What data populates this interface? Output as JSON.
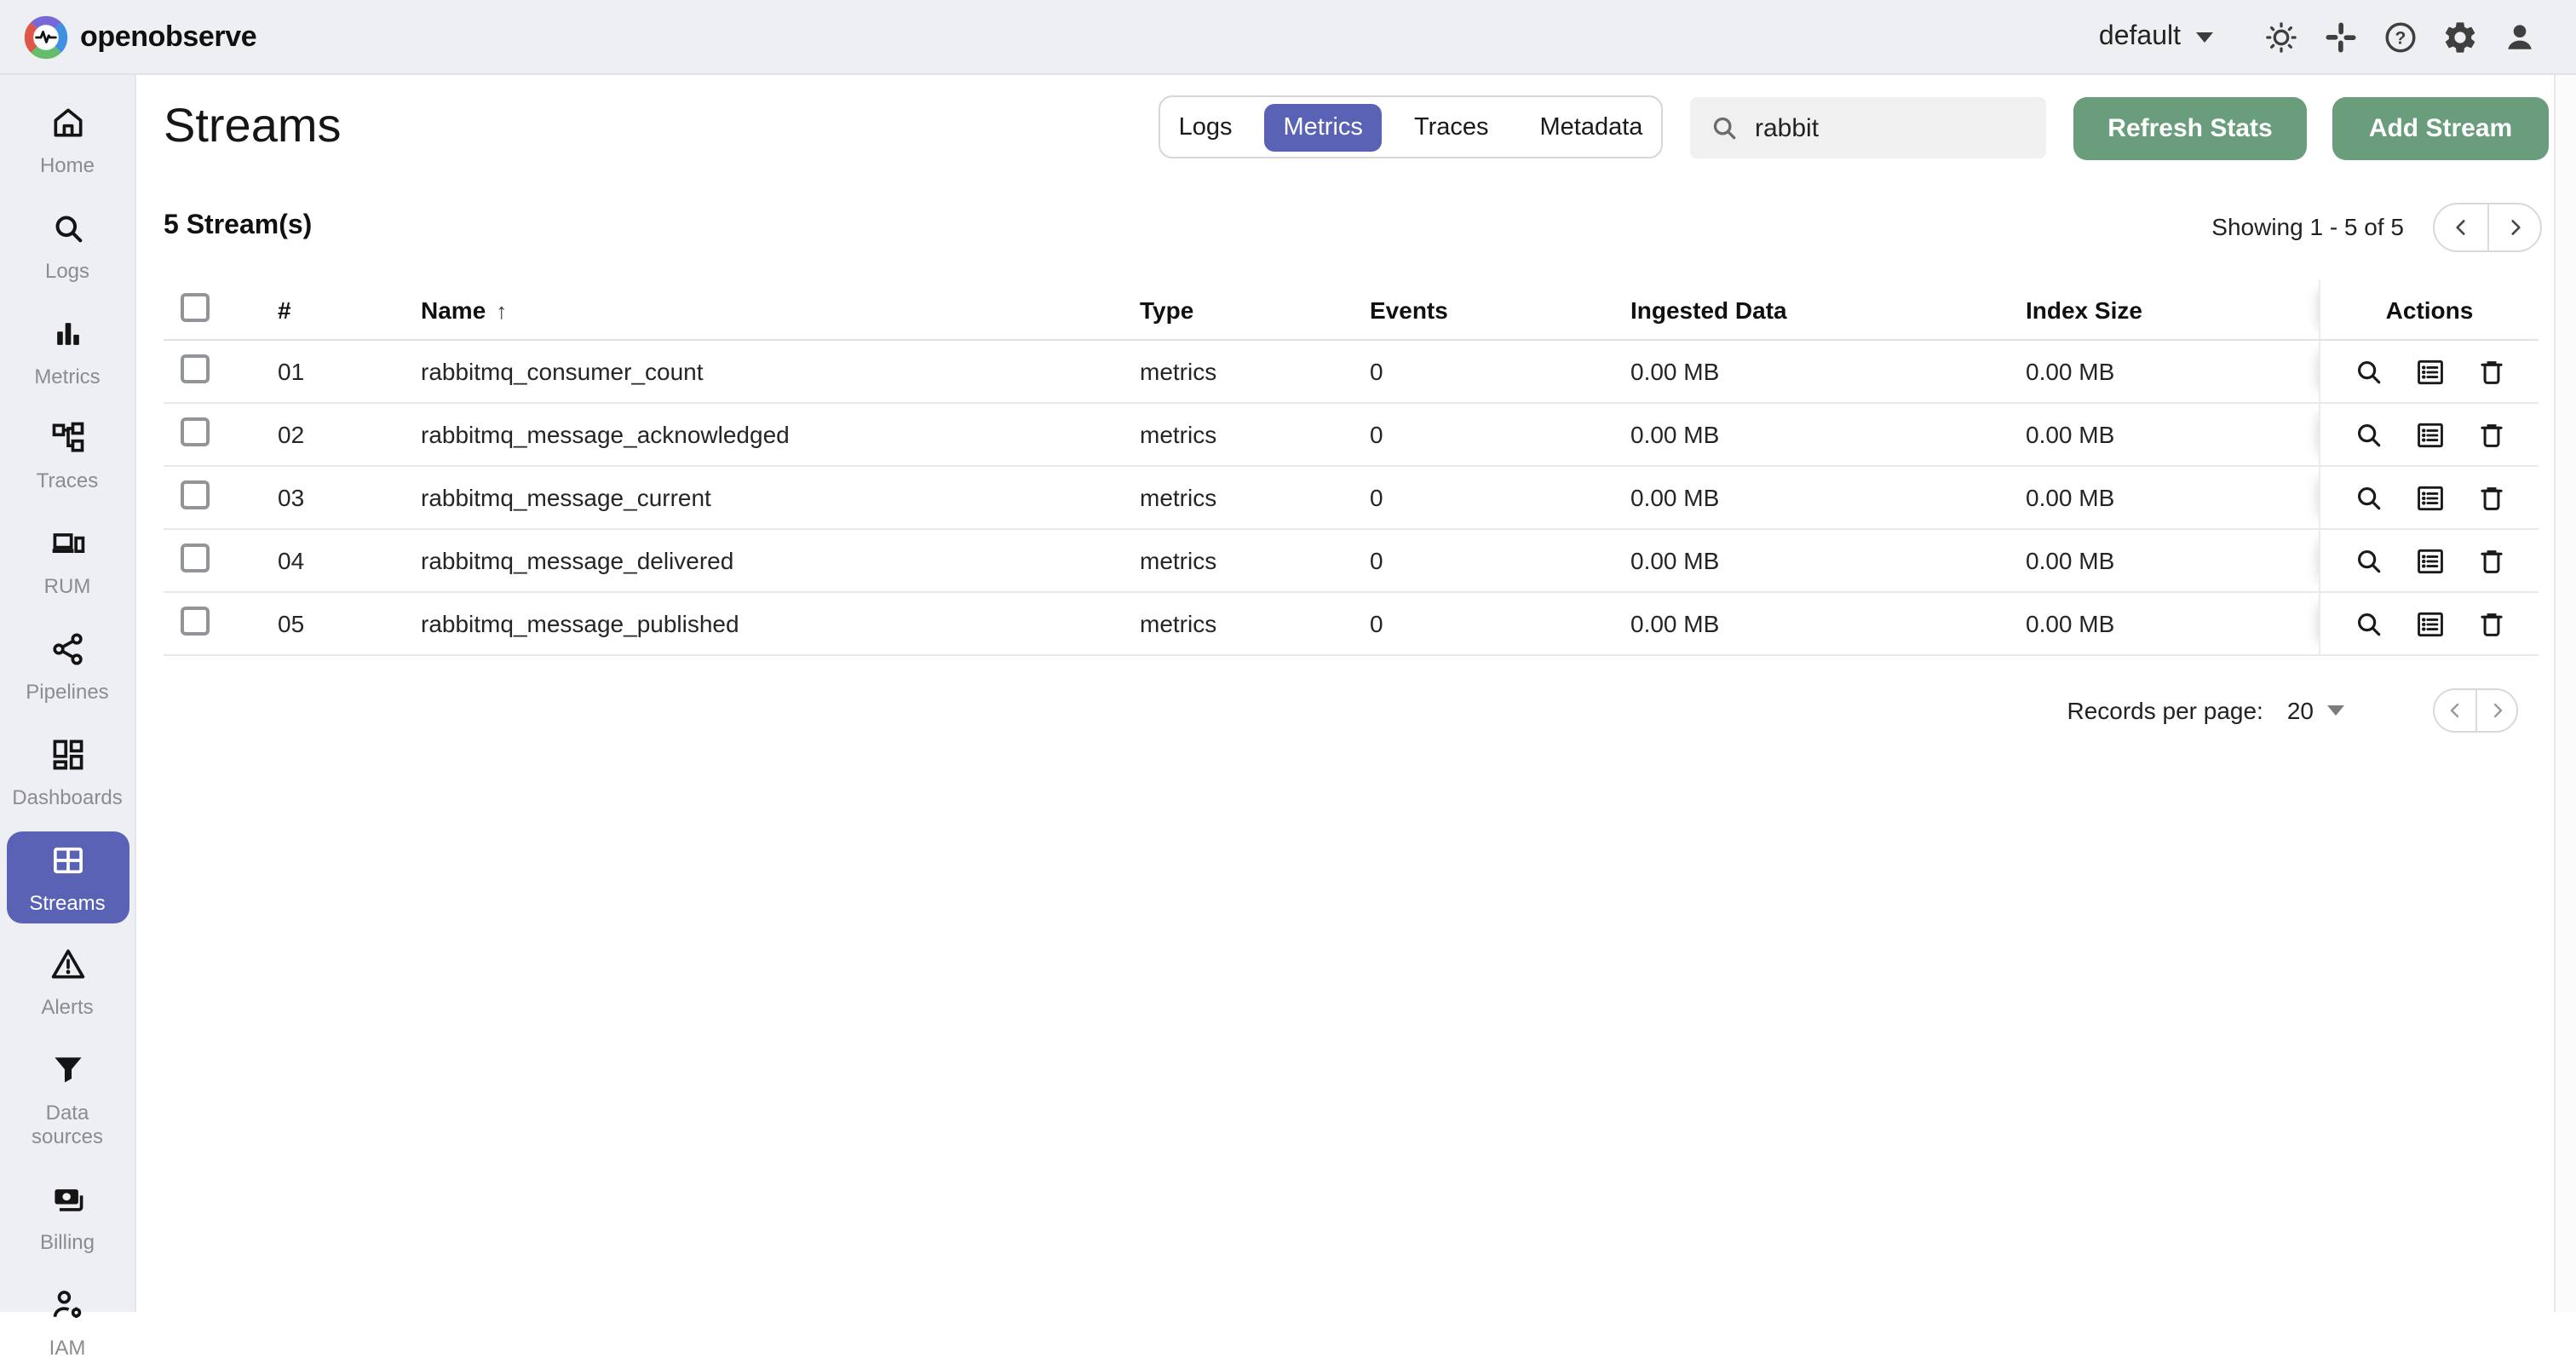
{
  "topbar": {
    "brand": "openobserve",
    "org": {
      "value": "default"
    },
    "icons": [
      {
        "name": "theme-toggle-icon"
      },
      {
        "name": "slack-icon"
      },
      {
        "name": "help-icon"
      },
      {
        "name": "settings-icon"
      },
      {
        "name": "profile-icon"
      }
    ]
  },
  "sidebar": {
    "items": [
      {
        "label": "Home",
        "icon": "home-icon",
        "active": false
      },
      {
        "label": "Logs",
        "icon": "search-icon",
        "active": false
      },
      {
        "label": "Metrics",
        "icon": "bar-chart-icon",
        "active": false
      },
      {
        "label": "Traces",
        "icon": "tree-icon",
        "active": false
      },
      {
        "label": "RUM",
        "icon": "devices-icon",
        "active": false
      },
      {
        "label": "Pipelines",
        "icon": "share-icon",
        "active": false
      },
      {
        "label": "Dashboards",
        "icon": "dashboard-icon",
        "active": false
      },
      {
        "label": "Streams",
        "icon": "grid-icon",
        "active": true
      },
      {
        "label": "Alerts",
        "icon": "warning-icon",
        "active": false
      },
      {
        "label": "Data sources",
        "icon": "filter-icon",
        "active": false
      },
      {
        "label": "Billing",
        "icon": "payments-icon",
        "active": false
      },
      {
        "label": "IAM",
        "icon": "user-settings-icon",
        "active": false
      }
    ]
  },
  "page": {
    "title": "Streams",
    "tabs": [
      {
        "label": "Logs",
        "active": false
      },
      {
        "label": "Metrics",
        "active": true
      },
      {
        "label": "Traces",
        "active": false
      },
      {
        "label": "Metadata",
        "active": false
      }
    ],
    "search": {
      "value": "rabbit"
    },
    "refresh_button": "Refresh Stats",
    "add_button": "Add Stream",
    "count_label": "5 Stream(s)",
    "showing_label": "Showing 1 - 5 of 5"
  },
  "table": {
    "columns": {
      "num": "#",
      "name": "Name",
      "sort_indicator": "↑",
      "type": "Type",
      "events": "Events",
      "ingested": "Ingested Data",
      "index_size": "Index Size",
      "actions": "Actions"
    },
    "row_action_icons": [
      "explore-icon",
      "schema-icon",
      "delete-icon"
    ],
    "rows": [
      {
        "num": "01",
        "name": "rabbitmq_consumer_count",
        "type": "metrics",
        "events": "0",
        "ingested": "0.00 MB",
        "index_size": "0.00 MB"
      },
      {
        "num": "02",
        "name": "rabbitmq_message_acknowledged",
        "type": "metrics",
        "events": "0",
        "ingested": "0.00 MB",
        "index_size": "0.00 MB"
      },
      {
        "num": "03",
        "name": "rabbitmq_message_current",
        "type": "metrics",
        "events": "0",
        "ingested": "0.00 MB",
        "index_size": "0.00 MB"
      },
      {
        "num": "04",
        "name": "rabbitmq_message_delivered",
        "type": "metrics",
        "events": "0",
        "ingested": "0.00 MB",
        "index_size": "0.00 MB"
      },
      {
        "num": "05",
        "name": "rabbitmq_message_published",
        "type": "metrics",
        "events": "0",
        "ingested": "0.00 MB",
        "index_size": "0.00 MB"
      }
    ]
  },
  "footer": {
    "records_per_page_label": "Records per page:",
    "records_per_page_value": "20"
  },
  "colors": {
    "accent_purple": "#5a62b5",
    "button_green": "#699d7c",
    "topbar_bg": "#edeff3",
    "logo_ring": [
      "#7668d8",
      "#3f8fe3",
      "#63bd6a",
      "#e05549"
    ]
  }
}
